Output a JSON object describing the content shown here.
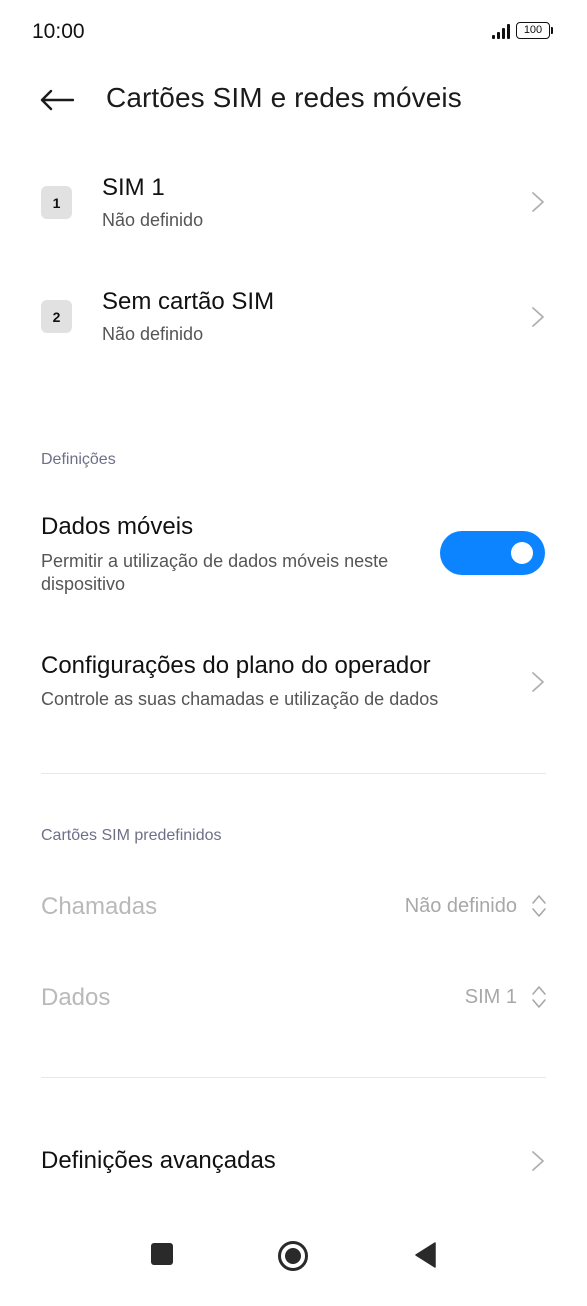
{
  "status_bar": {
    "time": "10:00",
    "battery_level": "100"
  },
  "header": {
    "title": "Cartões SIM e redes móveis"
  },
  "sim_cards": [
    {
      "badge": "1",
      "title": "SIM 1",
      "subtitle": "Não definido"
    },
    {
      "badge": "2",
      "title": "Sem cartão SIM",
      "subtitle": "Não definido"
    }
  ],
  "settings_section": {
    "label": "Definições",
    "mobile_data": {
      "title": "Dados móveis",
      "subtitle": "Permitir a utilização de dados móveis neste dispositivo",
      "enabled": true
    },
    "carrier_plan": {
      "title": "Configurações do plano do operador",
      "subtitle": "Controle as suas chamadas e utilização de dados"
    }
  },
  "default_sim_section": {
    "label": "Cartões SIM predefinidos",
    "calls": {
      "title": "Chamadas",
      "value": "Não definido"
    },
    "data": {
      "title": "Dados",
      "value": "SIM 1"
    }
  },
  "advanced": {
    "title": "Definições avançadas"
  },
  "colors": {
    "accent": "#0d84ff",
    "disabled_text": "#b9b9b9",
    "section_label": "#6d7088"
  },
  "nav_bar": {
    "icons": [
      "recents-square-icon",
      "home-circle-icon",
      "back-triangle-icon"
    ]
  }
}
